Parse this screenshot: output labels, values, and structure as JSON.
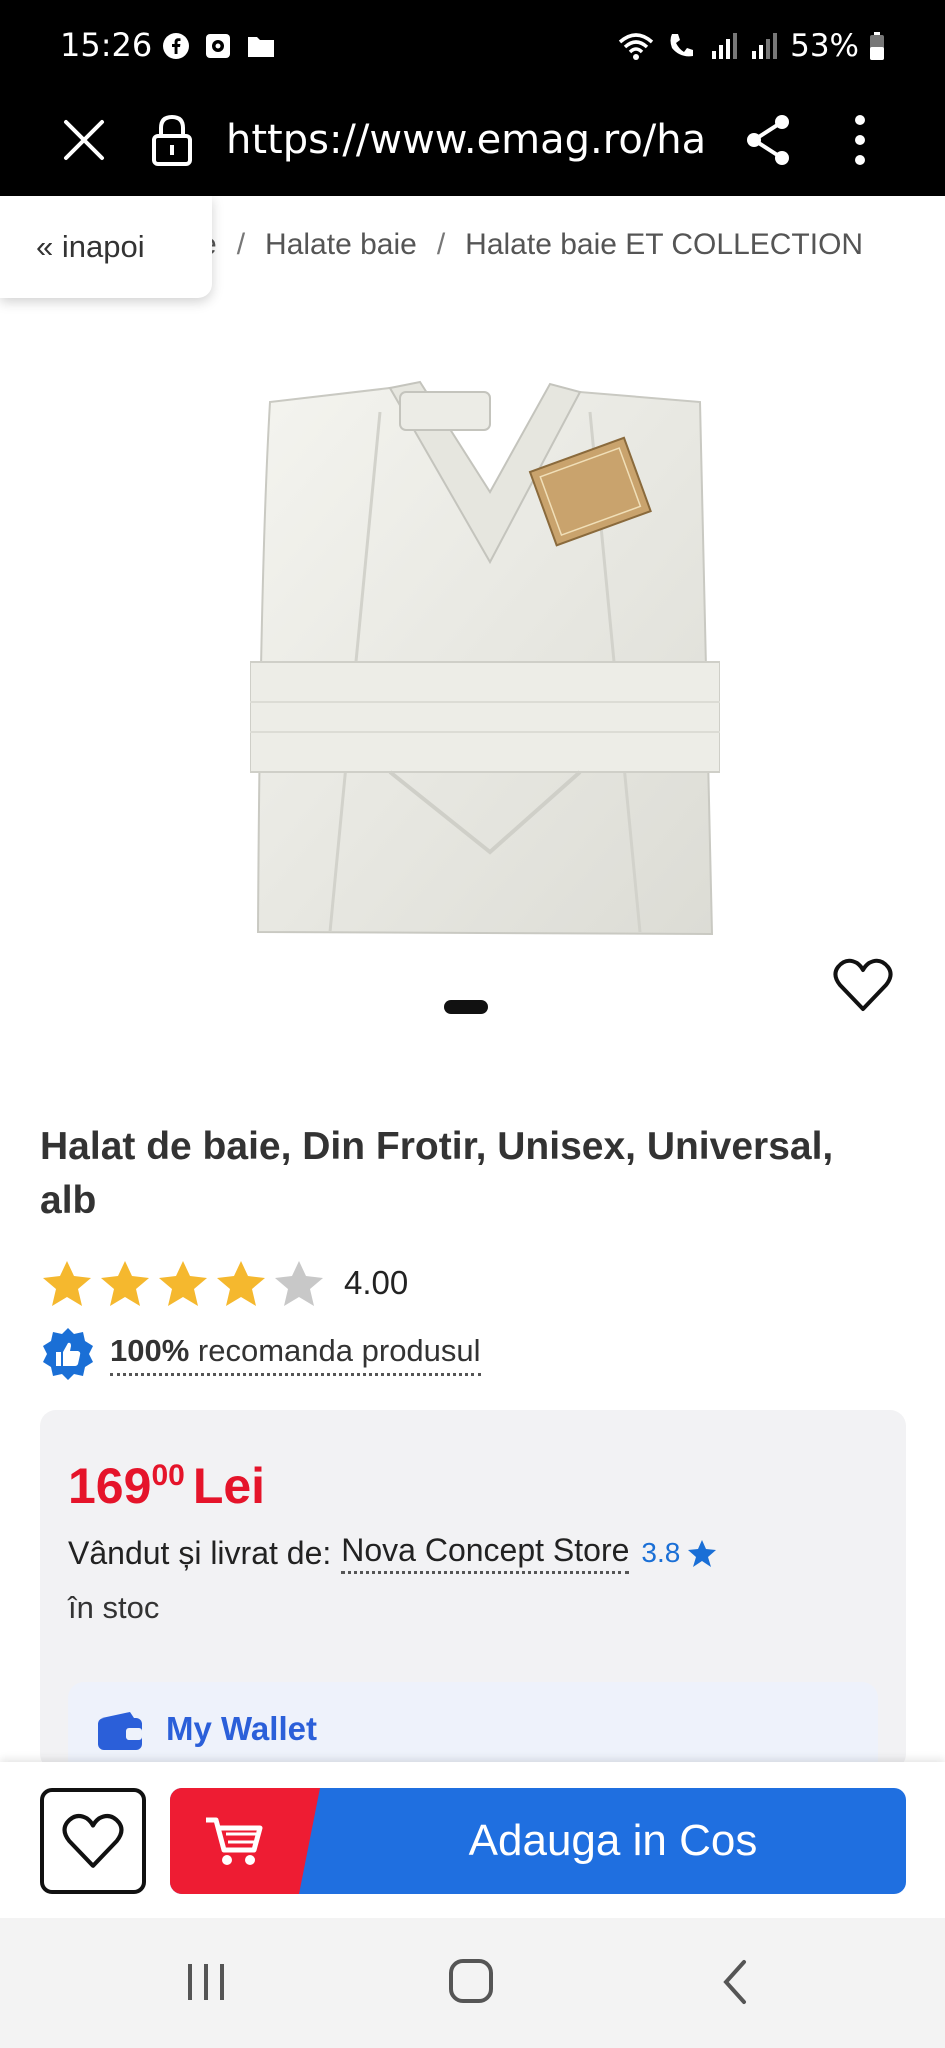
{
  "status_bar": {
    "time": "15:26",
    "battery": "53%",
    "left_icons": [
      "facebook-icon",
      "messenger-icon",
      "folder-icon"
    ],
    "right_icons": [
      "wifi-icon",
      "volte-call-icon",
      "signal-icon",
      "signal-icon",
      "battery-icon"
    ]
  },
  "browser": {
    "url": "https://www.emag.ro/halat-de-baie",
    "icons": [
      "close-icon",
      "lock-icon",
      "share-icon",
      "more-vertical-icon"
    ]
  },
  "breadcrumb": {
    "back_label": "« inapoi",
    "items": [
      "e",
      "Halate baie",
      "Halate baie ET COLLECTION"
    ],
    "separator": "/"
  },
  "product": {
    "title": "Halat de baie, Din Frotir, Unisex, Universal, alb",
    "rating_value": "4.00",
    "rating_stars": 4,
    "rating_max": 5,
    "recommend_percent": "100%",
    "recommend_text": "recomanda produsul"
  },
  "offer": {
    "price_int": "169",
    "price_dec": "00",
    "currency": "Lei",
    "sold_by_label": "Vândut și livrat de:",
    "seller_name": "Nova Concept Store",
    "seller_rating": "3.8",
    "stock": "în stoc",
    "wallet_label": "My Wallet"
  },
  "actions": {
    "add_to_cart_label": "Adauga in Cos"
  },
  "colors": {
    "price_red": "#e5142a",
    "cart_blue": "#1f6fe0",
    "cart_red": "#ee1c33",
    "star_gold": "#f5b82e",
    "link_blue": "#1a6fd6"
  }
}
